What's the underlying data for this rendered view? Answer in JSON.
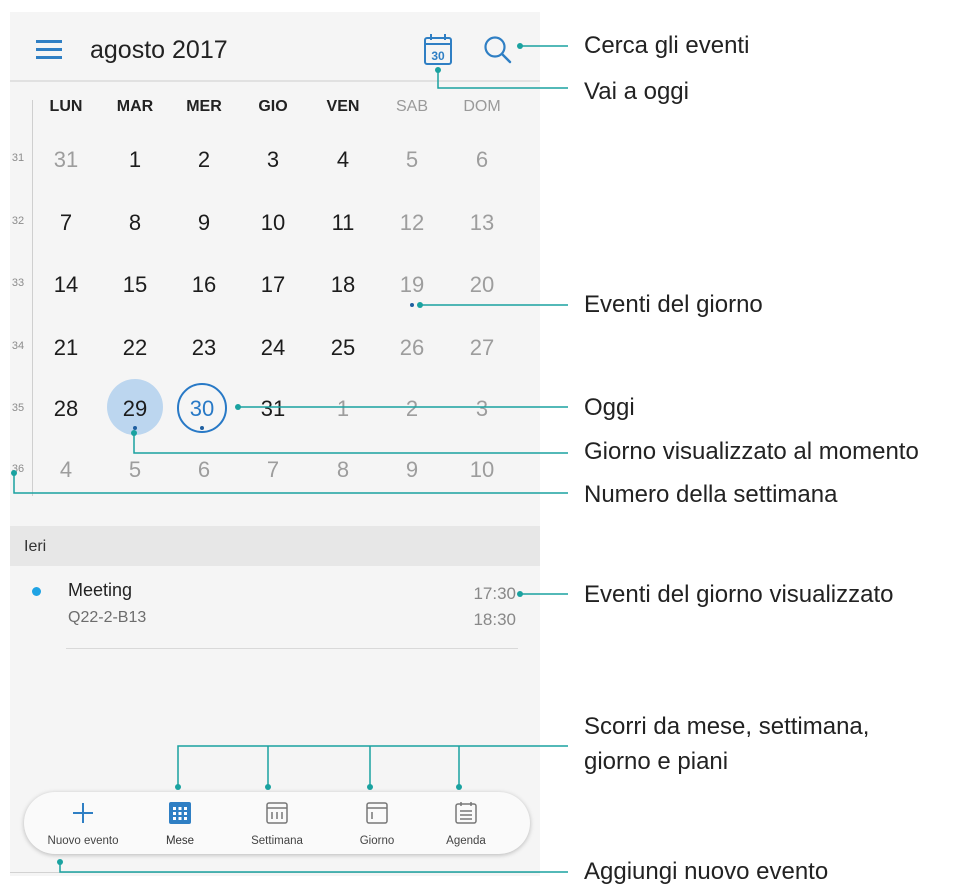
{
  "header": {
    "title": "agosto 2017",
    "today_icon_number": "30",
    "icons": {
      "menu": "hamburger-menu-icon",
      "today": "calendar-today-icon",
      "search": "search-icon"
    }
  },
  "weekdays": [
    "LUN",
    "MAR",
    "MER",
    "GIO",
    "VEN",
    "SAB",
    "DOM"
  ],
  "weeks": [
    {
      "number": "31",
      "days": [
        "31",
        "1",
        "2",
        "3",
        "4",
        "5",
        "6"
      ]
    },
    {
      "number": "32",
      "days": [
        "7",
        "8",
        "9",
        "10",
        "11",
        "12",
        "13"
      ]
    },
    {
      "number": "33",
      "days": [
        "14",
        "15",
        "16",
        "17",
        "18",
        "19",
        "20"
      ]
    },
    {
      "number": "34",
      "days": [
        "21",
        "22",
        "23",
        "24",
        "25",
        "26",
        "27"
      ]
    },
    {
      "number": "35",
      "days": [
        "28",
        "29",
        "30",
        "31",
        "1",
        "2",
        "3"
      ]
    },
    {
      "number": "36",
      "days": [
        "4",
        "5",
        "6",
        "7",
        "8",
        "9",
        "10"
      ]
    }
  ],
  "calendar_state": {
    "selected_day": "29",
    "today": "30",
    "days_with_events": [
      "19",
      "29",
      "30"
    ]
  },
  "agenda": {
    "section_label": "Ieri",
    "event": {
      "title": "Meeting",
      "location": "Q22-2-B13",
      "start": "17:30",
      "end": "18:30"
    }
  },
  "tabs": [
    {
      "label": "Nuovo evento",
      "icon": "plus-icon"
    },
    {
      "label": "Mese",
      "icon": "month-grid-icon"
    },
    {
      "label": "Settimana",
      "icon": "week-view-icon"
    },
    {
      "label": "Giorno",
      "icon": "day-view-icon"
    },
    {
      "label": "Agenda",
      "icon": "agenda-list-icon"
    }
  ],
  "callouts": {
    "search": "Cerca gli eventi",
    "today": "Vai a oggi",
    "day_events": "Eventi del giorno",
    "today_day": "Oggi",
    "selected_day": "Giorno visualizzato al momento",
    "week_number": "Numero della settimana",
    "shown_day_events": "Eventi del giorno visualizzato",
    "views_line1": "Scorri da mese, settimana,",
    "views_line2": "giorno e piani",
    "new_event": "Aggiungi nuovo evento"
  },
  "colors": {
    "accent": "#2879c6",
    "selected_fill": "#bcd6ef",
    "callout_line": "#1aa2a0",
    "event_dot": "#1fa3e4"
  }
}
